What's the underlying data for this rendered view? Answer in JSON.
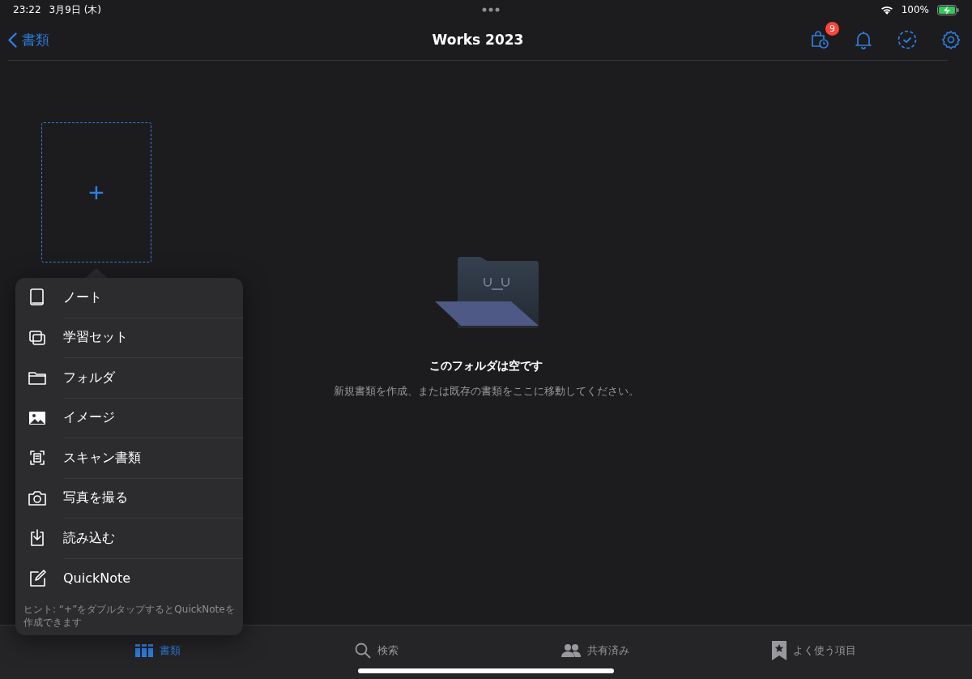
{
  "status_bar": {
    "time": "23:22",
    "date": "3月9日 (木)",
    "battery": "100%"
  },
  "nav": {
    "back": "書類",
    "title": "Works 2023",
    "badge": "9"
  },
  "empty_state": {
    "title": "このフォルダは空です",
    "message": "新規書類を作成、または既存の書類をここに移動してください。"
  },
  "add_card": {
    "symbol": "+"
  },
  "menu": {
    "items": [
      {
        "label": "ノート"
      },
      {
        "label": "学習セット"
      },
      {
        "label": "フォルダ"
      },
      {
        "label": "イメージ"
      },
      {
        "label": "スキャン書類"
      },
      {
        "label": "写真を撮る"
      },
      {
        "label": "読み込む"
      },
      {
        "label": "QuickNote"
      }
    ],
    "hint": "ヒント: “+”をダブルタップするとQuickNoteを作成できます"
  },
  "tabs": [
    {
      "label": "書類",
      "selected": true
    },
    {
      "label": "検索",
      "selected": false
    },
    {
      "label": "共有済み",
      "selected": false
    },
    {
      "label": "よく使う項目",
      "selected": false
    }
  ]
}
